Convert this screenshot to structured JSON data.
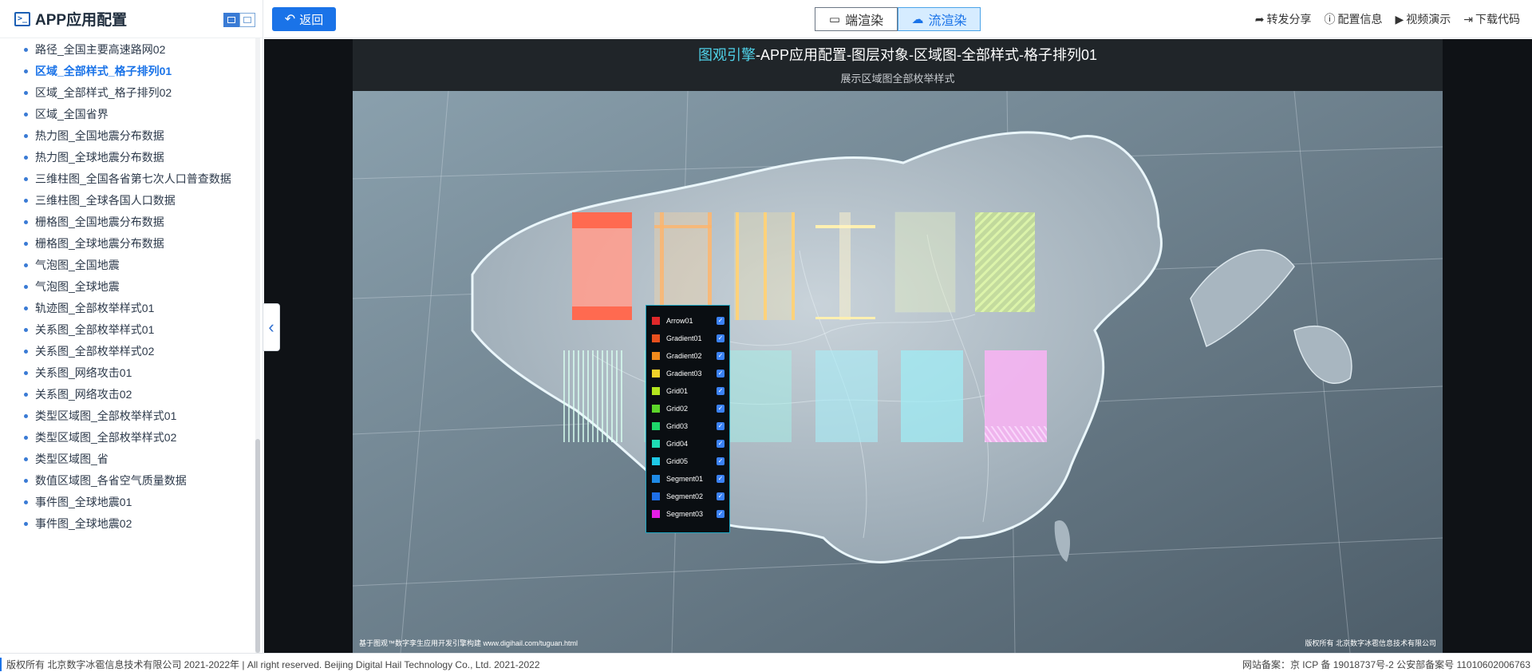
{
  "sidebar": {
    "title": "APP应用配置",
    "logo_icon": "screen-icon",
    "items": [
      "路径_全国主要高速路网02",
      "区域_全部样式_格子排列01",
      "区域_全部样式_格子排列02",
      "区域_全国省界",
      "热力图_全国地震分布数据",
      "热力图_全球地震分布数据",
      "三维柱图_全国各省第七次人口普查数据",
      "三维柱图_全球各国人口数据",
      "栅格图_全国地震分布数据",
      "栅格图_全球地震分布数据",
      "气泡图_全国地震",
      "气泡图_全球地震",
      "轨迹图_全部枚举样式01",
      "关系图_全部枚举样式01",
      "关系图_全部枚举样式02",
      "关系图_网络攻击01",
      "关系图_网络攻击02",
      "类型区域图_全部枚举样式01",
      "类型区域图_全部枚举样式02",
      "类型区域图_省",
      "数值区域图_各省空气质量数据",
      "事件图_全球地震01",
      "事件图_全球地震02"
    ],
    "active_index": 1
  },
  "topbar": {
    "back_label": "返回",
    "render_client_label": "端渲染",
    "render_stream_label": "流渲染",
    "actions": {
      "share": "转发分享",
      "config_info": "配置信息",
      "video_demo": "视频演示",
      "download_code": "下载代码"
    }
  },
  "viewport": {
    "title_brand": "图观引擎",
    "title_rest": "-APP应用配置-图层对象-区域图-全部样式-格子排列01",
    "subtitle": "展示区域图全部枚举样式",
    "footer_left": "基于图观™数字孪生应用开发引擎构建 www.digihail.com/tuguan.html",
    "footer_right": "版权所有 北京数字冰雹信息技术有限公司"
  },
  "legend": {
    "items": [
      {
        "name": "Arrow01",
        "color": "#e0282a",
        "checked": true
      },
      {
        "name": "Gradient01",
        "color": "#e8501e",
        "checked": true
      },
      {
        "name": "Gradient02",
        "color": "#f08a1c",
        "checked": true
      },
      {
        "name": "Gradient03",
        "color": "#f2d22a",
        "checked": true
      },
      {
        "name": "Grid01",
        "color": "#b4e61e",
        "checked": true
      },
      {
        "name": "Grid02",
        "color": "#5cd62a",
        "checked": true
      },
      {
        "name": "Grid03",
        "color": "#1ed66a",
        "checked": true
      },
      {
        "name": "Grid04",
        "color": "#1edcb4",
        "checked": true
      },
      {
        "name": "Grid05",
        "color": "#1ec8e6",
        "checked": true
      },
      {
        "name": "Segment01",
        "color": "#1e8ae6",
        "checked": true
      },
      {
        "name": "Segment02",
        "color": "#1e6ee6",
        "checked": true
      },
      {
        "name": "Segment03",
        "color": "#e61ee6",
        "checked": true
      }
    ]
  },
  "footer": {
    "left": "版权所有 北京数字冰雹信息技术有限公司 2021-2022年 | All right reserved. Beijing Digital Hail Technology Co., Ltd. 2021-2022",
    "right": "网站备案：京 ICP 备 19018737号-2 公安部备案号 11010602006763"
  }
}
